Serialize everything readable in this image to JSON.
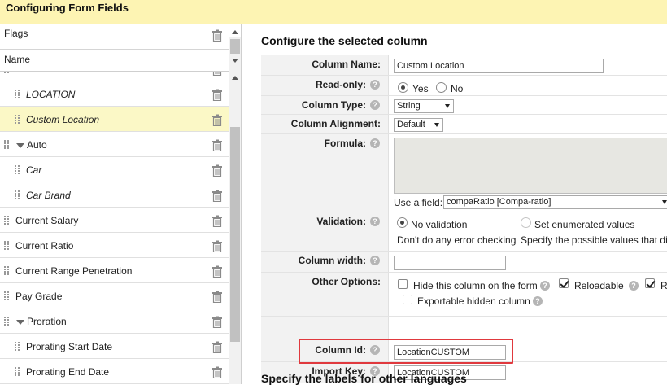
{
  "window": {
    "title": "Configuring Form Fields"
  },
  "left": {
    "flags_label": "Flags",
    "name_label": "Name",
    "items": [
      {
        "label": "LOCATION",
        "italic": true,
        "indent": 2
      },
      {
        "label": "Custom Location",
        "italic": true,
        "indent": 2,
        "selected": true
      },
      {
        "label": "Auto",
        "italic": false,
        "indent": 1,
        "group": true
      },
      {
        "label": "Car",
        "italic": true,
        "indent": 2
      },
      {
        "label": "Car Brand",
        "italic": true,
        "indent": 2
      },
      {
        "label": "Current Salary",
        "italic": false,
        "indent": 1
      },
      {
        "label": "Current Ratio",
        "italic": false,
        "indent": 1
      },
      {
        "label": "Current Range Penetration",
        "italic": false,
        "indent": 1
      },
      {
        "label": "Pay Grade",
        "italic": false,
        "indent": 1
      },
      {
        "label": "Proration",
        "italic": false,
        "indent": 1,
        "group": true
      },
      {
        "label": "Prorating Start Date",
        "italic": false,
        "indent": 2
      },
      {
        "label": "Prorating End Date",
        "italic": false,
        "indent": 2
      }
    ]
  },
  "right": {
    "heading": "Configure the selected column",
    "bottom_heading": "Specify the labels for other languages",
    "help_glyph": "?",
    "column_name": {
      "label": "Column Name:",
      "value": "Custom Location"
    },
    "read_only": {
      "label": "Read-only:",
      "yes": "Yes",
      "no": "No"
    },
    "column_type": {
      "label": "Column Type:",
      "value": "String"
    },
    "column_alignment": {
      "label": "Column Alignment:",
      "value": "Default"
    },
    "formula": {
      "label": "Formula:",
      "use_field_label": "Use a field:",
      "use_field_value": "compaRatio [Compa-ratio]"
    },
    "validation": {
      "label": "Validation:",
      "opt1": "No validation",
      "opt2": "Set enumerated values",
      "desc1": "Don't do any error checking",
      "desc2": "Specify the possible values that di"
    },
    "column_width": {
      "label": "Column width:",
      "value": ""
    },
    "other_options": {
      "label": "Other Options:",
      "hide": "Hide this column on the form",
      "reloadable": "Reloadable",
      "r": "R",
      "exportable": "Exportable hidden column"
    },
    "column_id": {
      "label": "Column Id:",
      "value": "LocationCUSTOM"
    },
    "import_key": {
      "label": "Import Key:",
      "value": "LocationCUSTOM"
    }
  },
  "colors": {
    "title_bg": "#fdf4b3",
    "selected_row": "#fbf8c6",
    "highlight": "#e0393e"
  }
}
